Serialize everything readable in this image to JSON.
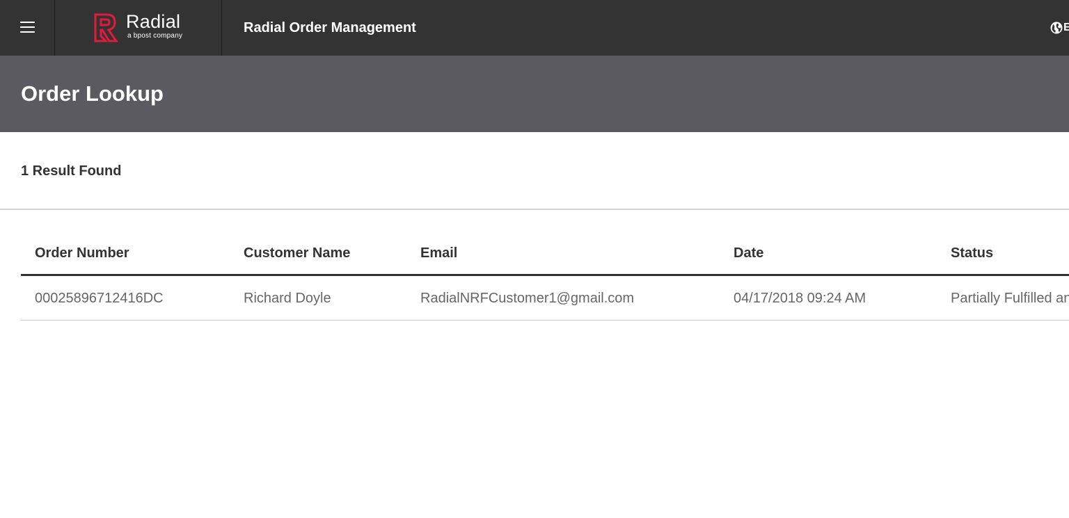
{
  "header": {
    "brand": {
      "name": "Radial",
      "tagline": "a bpost company",
      "accent_color": "#e21b3c"
    },
    "app_title": "Radial Order Management",
    "menu_icon": "hamburger-icon",
    "globe_icon": "globe-icon",
    "globe_label": "E"
  },
  "page": {
    "title": "Order Lookup",
    "result_count": "1 Result Found"
  },
  "table": {
    "columns": [
      "Order Number",
      "Customer Name",
      "Email",
      "Date",
      "Status"
    ],
    "rows": [
      {
        "order_number": "00025896712416DC",
        "customer_name": "Richard Doyle",
        "email": "RadialNRFCustomer1@gmail.com",
        "date": "04/17/2018 09:24 AM",
        "status": "Partially Fulfilled and Shipped"
      }
    ]
  }
}
